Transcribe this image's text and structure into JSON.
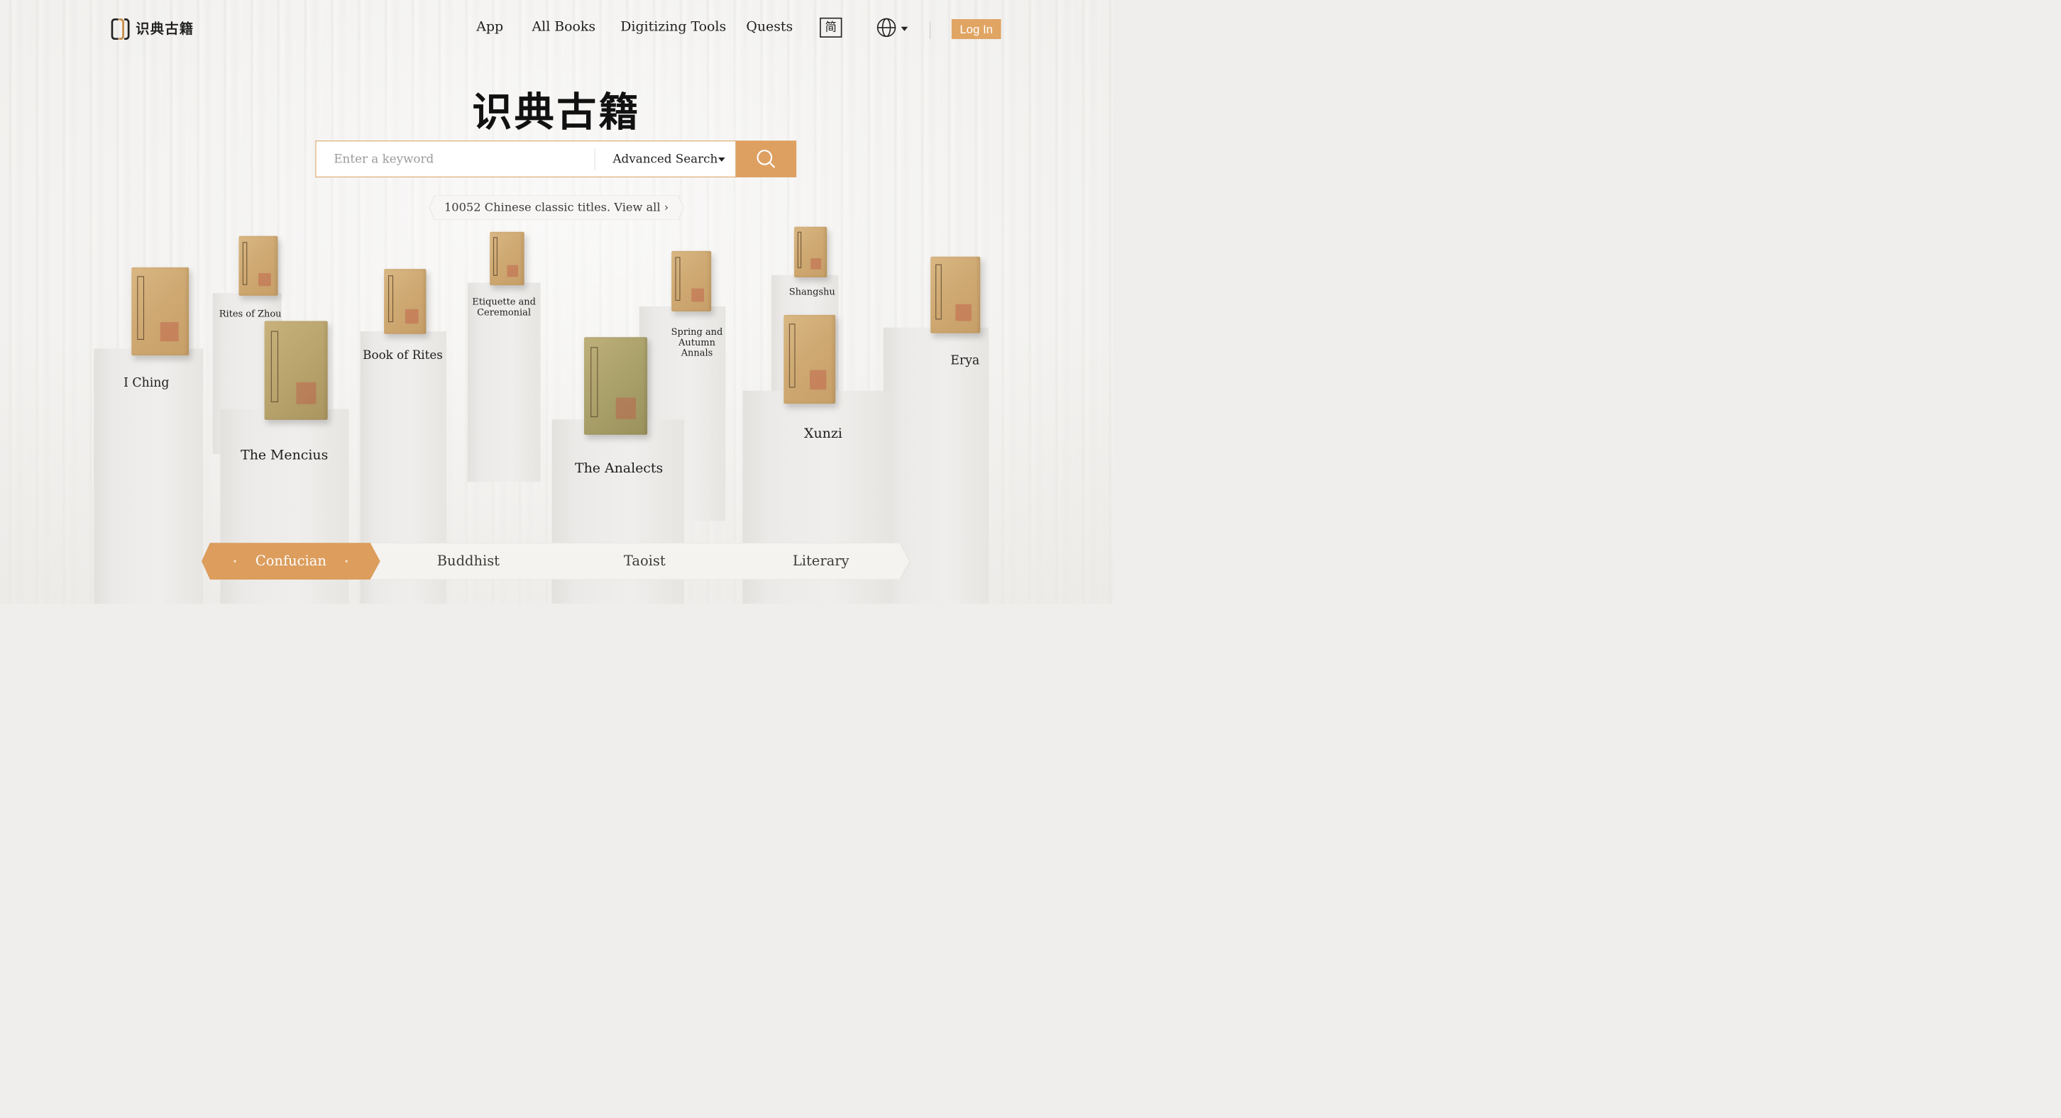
{
  "brand": {
    "logo_text": "识典古籍",
    "hero_title": "识典古籍",
    "accent": "#dea061"
  },
  "nav": {
    "app": "App",
    "all_books": "All Books",
    "digitizing_tools": "Digitizing Tools",
    "quests": "Quests",
    "script_toggle": "简",
    "login": "Log In"
  },
  "search": {
    "placeholder": "Enter a keyword",
    "value": "",
    "advanced_label": "Advanced Search"
  },
  "catalog_link": "10052 Chinese classic titles. View all ›",
  "books": [
    "I Ching",
    "Rites of Zhou",
    "The Mencius",
    "Book of Rites",
    "Etiquette and Ceremonial",
    "The Analects",
    "Spring and Autumn Annals",
    "Shangshu",
    "Xunzi",
    "Erya"
  ],
  "tabs": [
    "Confucian",
    "Buddhist",
    "Taoist",
    "Literary"
  ],
  "active_tab": "Confucian"
}
